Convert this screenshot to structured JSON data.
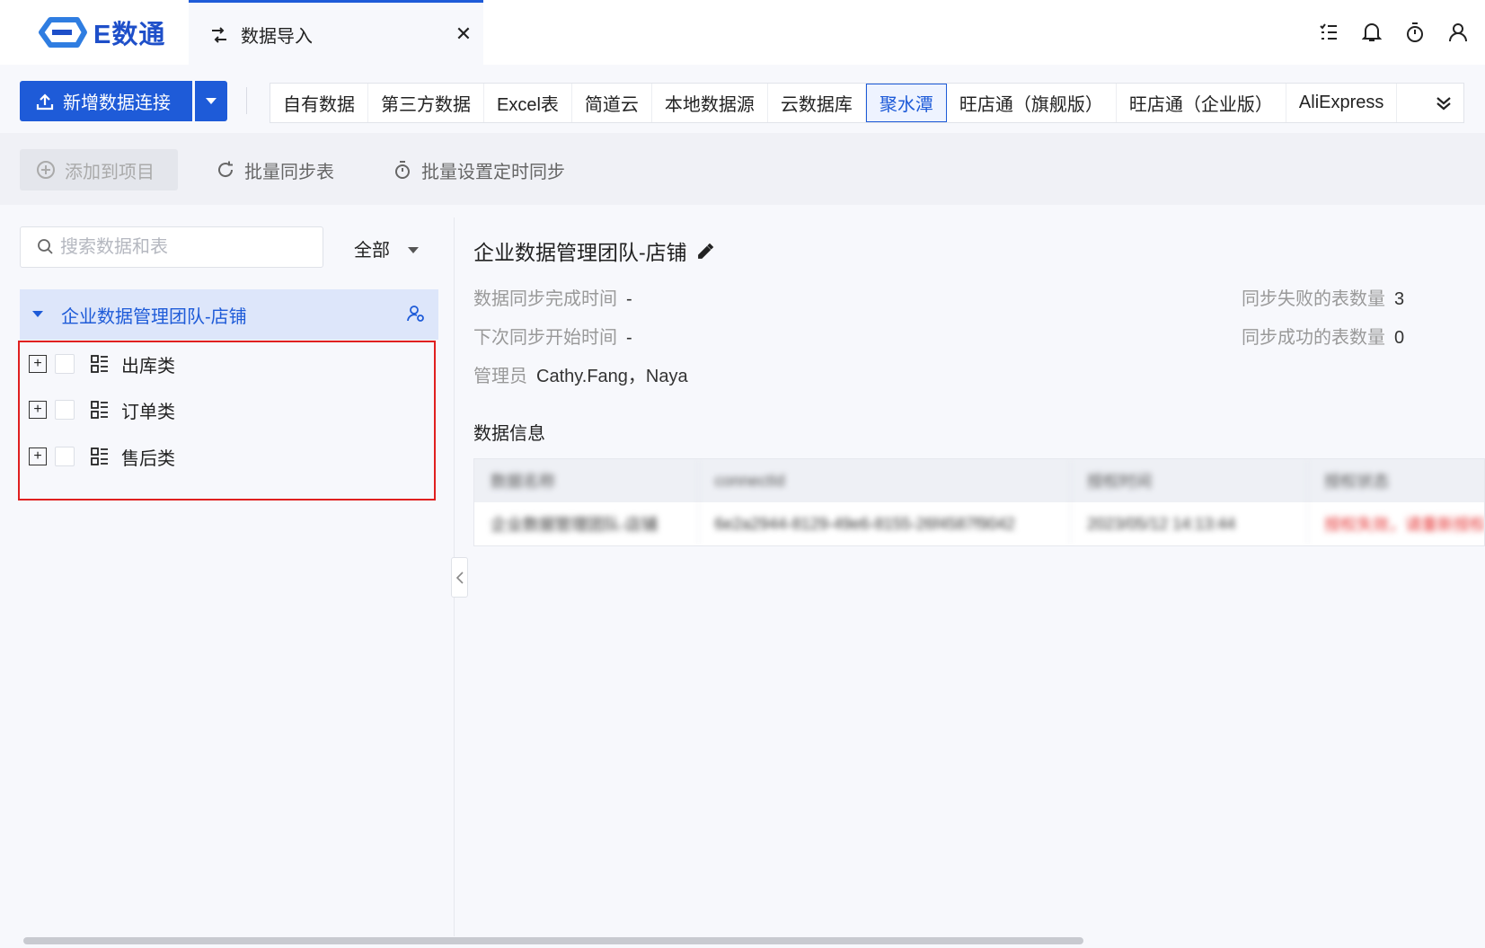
{
  "app": {
    "logo_text": "E数通",
    "tab_label": "数据导入",
    "tab_close": "✕"
  },
  "toolbar": {
    "new_connection_label": "新增数据连接",
    "source_tabs": [
      "自有数据",
      "第三方数据",
      "Excel表",
      "简道云",
      "本地数据源",
      "云数据库",
      "聚水潭",
      "旺店通（旗舰版）",
      "旺店通（企业版）",
      "AliExpress"
    ],
    "active_source_tab": "聚水潭"
  },
  "actions": {
    "add_to_project": "添加到项目",
    "batch_sync": "批量同步表",
    "batch_schedule": "批量设置定时同步"
  },
  "left_panel": {
    "search_placeholder": "搜索数据和表",
    "filter_value": "全部",
    "root_label": "企业数据管理团队-店铺",
    "nodes": [
      "出库类",
      "订单类",
      "售后类"
    ]
  },
  "detail": {
    "title": "企业数据管理团队-店铺",
    "sync_done_label": "数据同步完成时间",
    "sync_done_value": "-",
    "next_sync_label": "下次同步开始时间",
    "next_sync_value": "-",
    "admin_label": "管理员",
    "admin_value": "Cathy.Fang，Naya",
    "fail_count_label": "同步失败的表数量",
    "fail_count_value": "3",
    "success_count_label": "同步成功的表数量",
    "success_count_value": "0",
    "section_title": "数据信息"
  },
  "table": {
    "headers": [
      "数据名称",
      "connectId",
      "授权时间",
      "授权状态"
    ],
    "row": [
      "企业数据管理团队-店铺",
      "6e2a2944-8129-49e6-8155-26f4587f9042",
      "2023/05/12 14:13:44",
      "授权失效，请重新授权"
    ]
  },
  "colors": {
    "primary": "#1e5bd8",
    "highlight_border": "#e02020",
    "error_text": "#e53030"
  }
}
